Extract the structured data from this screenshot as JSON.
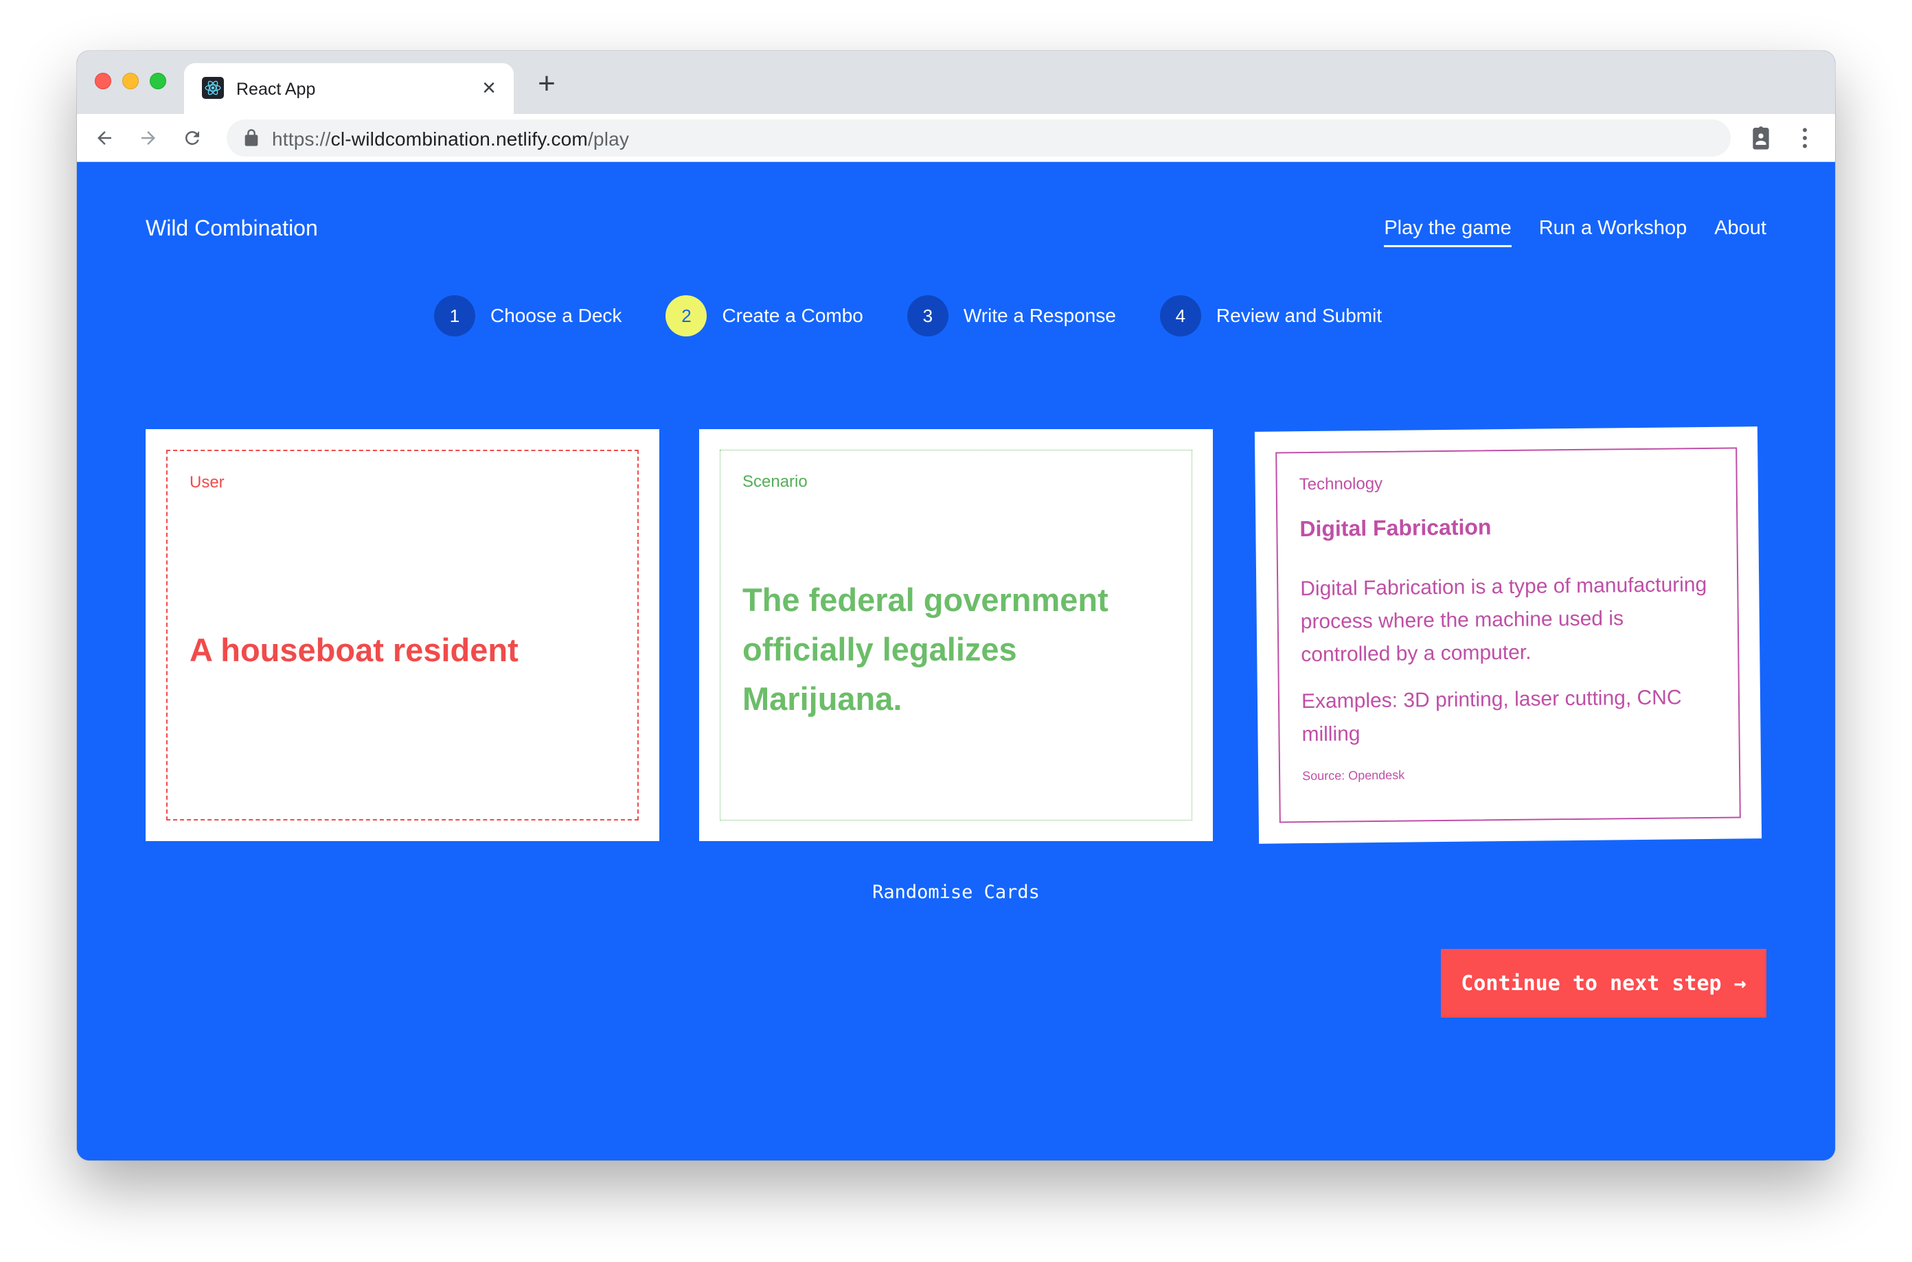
{
  "browser": {
    "tab_title": "React App",
    "tab_close": "×",
    "new_tab": "+",
    "url_scheme": "https://",
    "url_host": "cl-wildcombination.netlify.com",
    "url_path": "/play"
  },
  "header": {
    "brand": "Wild Combination",
    "nav": [
      {
        "label": "Play the game",
        "active": true
      },
      {
        "label": "Run a Workshop",
        "active": false
      },
      {
        "label": "About",
        "active": false
      }
    ]
  },
  "steps": [
    {
      "num": "1",
      "label": "Choose a Deck",
      "current": false
    },
    {
      "num": "2",
      "label": "Create a Combo",
      "current": true
    },
    {
      "num": "3",
      "label": "Write a Response",
      "current": false
    },
    {
      "num": "4",
      "label": "Review and Submit",
      "current": false
    }
  ],
  "cards": {
    "user": {
      "category": "User",
      "text": "A houseboat resident"
    },
    "scenario": {
      "category": "Scenario",
      "text": "The federal government officially legalizes Marijuana."
    },
    "technology": {
      "category": "Technology",
      "title": "Digital Fabrication",
      "description": "Digital Fabrication is a type of manufacturing process where the machine used is controlled by a computer.",
      "examples": "Examples: 3D printing, laser cutting, CNC milling",
      "source": "Source: Opendesk"
    }
  },
  "actions": {
    "randomise": "Randomise Cards",
    "continue": "Continue to next step →"
  },
  "colors": {
    "page_bg": "#1565fc",
    "user": "#f04b4b",
    "scenario": "#6cbd69",
    "technology": "#bf4fa6",
    "step_current": "#eef56a",
    "continue_bg": "#fc4d4f"
  }
}
